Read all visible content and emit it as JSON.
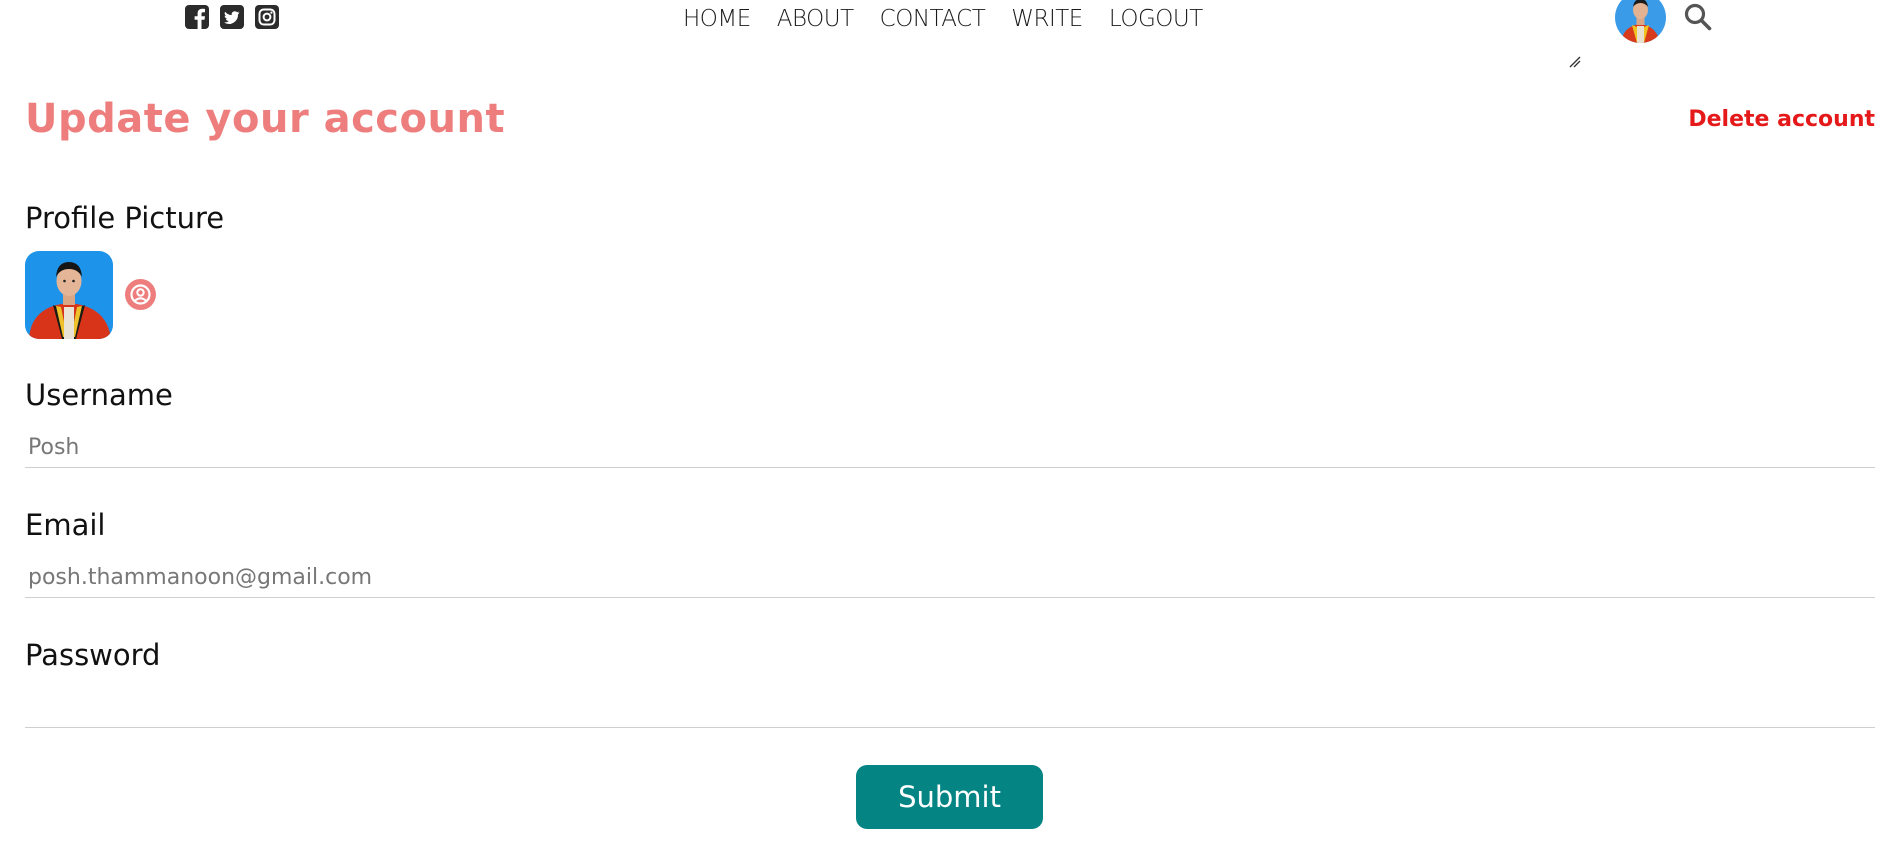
{
  "header": {
    "social": [
      {
        "icon": "facebook-icon"
      },
      {
        "icon": "twitter-icon"
      },
      {
        "icon": "instagram-icon"
      }
    ],
    "nav": [
      "HOME",
      "ABOUT",
      "CONTACT",
      "WRITE",
      "LOGOUT"
    ],
    "search_icon": "search-icon"
  },
  "form": {
    "title": "Update your account",
    "delete_label": "Delete account",
    "profile_picture_label": "Profile Picture",
    "upload_icon": "user-circle-icon",
    "username_label": "Username",
    "username_placeholder": "Posh",
    "email_label": "Email",
    "email_placeholder": "posh.thammanoon@gmail.com",
    "password_label": "Password",
    "password_placeholder": "",
    "submit_label": "Submit"
  },
  "colors": {
    "accent": "#ee7e7e",
    "danger": "#e51919",
    "submit": "#048584"
  }
}
